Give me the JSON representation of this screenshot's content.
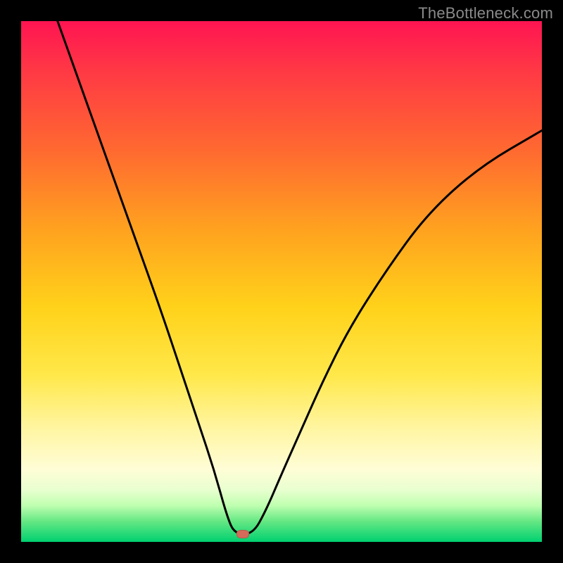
{
  "attribution": "TheBottleneck.com",
  "marker": {
    "x_frac": 0.425,
    "y_frac": 0.985
  },
  "colors": {
    "frame": "#000000",
    "curve": "#000000",
    "marker": "#d46a5a",
    "gradient_top": "#ff1452",
    "gradient_bottom": "#00d070"
  },
  "chart_data": {
    "type": "line",
    "title": "",
    "xlabel": "",
    "ylabel": "",
    "xlim": [
      0,
      1
    ],
    "ylim": [
      0,
      1
    ],
    "notes": "Axes are unlabeled in the source image; fractions 0..1 map to plot width/height. y=0 is the bottom (green band), y=1 is the top (red band). The curve is a V-shape reaching ~0 near x≈0.42 with a small flat segment at the bottom, rising steeply to the left edge (y≈1 at x≈0.07) and more gently to the right edge (y≈0.79 at x=1).",
    "series": [
      {
        "name": "bottleneck-curve",
        "x": [
          0.07,
          0.12,
          0.17,
          0.22,
          0.27,
          0.31,
          0.34,
          0.37,
          0.395,
          0.41,
          0.445,
          0.47,
          0.5,
          0.54,
          0.58,
          0.63,
          0.7,
          0.78,
          0.88,
          1.0
        ],
        "y": [
          1.0,
          0.86,
          0.72,
          0.58,
          0.44,
          0.32,
          0.23,
          0.14,
          0.05,
          0.015,
          0.015,
          0.06,
          0.13,
          0.22,
          0.31,
          0.41,
          0.52,
          0.63,
          0.72,
          0.79
        ]
      }
    ],
    "marker_point": {
      "x": 0.425,
      "y": 0.015
    }
  }
}
